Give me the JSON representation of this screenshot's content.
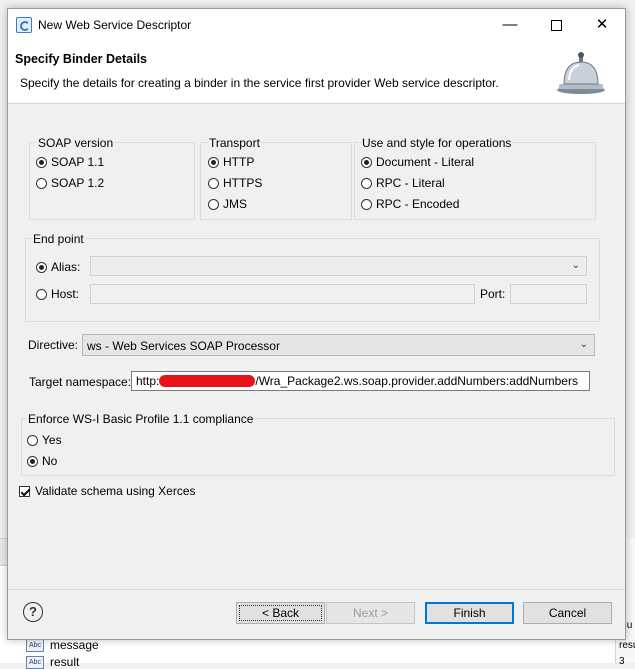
{
  "background_app": {
    "rows": [
      "message",
      "result"
    ],
    "right_col": [
      "alu",
      "resu",
      "3"
    ]
  },
  "window": {
    "title": "New Web Service Descriptor",
    "minimize": "—",
    "close": "✕"
  },
  "header": {
    "title": "Specify Binder Details",
    "description": "Specify the details for creating a binder in the service first provider Web service descriptor."
  },
  "soap_version": {
    "label": "SOAP version",
    "options": [
      "SOAP 1.1",
      "SOAP 1.2"
    ],
    "selected": "SOAP 1.1"
  },
  "transport": {
    "label": "Transport",
    "options": [
      "HTTP",
      "HTTPS",
      "JMS"
    ],
    "selected": "HTTP"
  },
  "use_style": {
    "label": "Use and style for operations",
    "options": [
      "Document - Literal",
      "RPC - Literal",
      "RPC - Encoded"
    ],
    "selected": "Document - Literal"
  },
  "endpoint": {
    "label": "End point",
    "alias_label": "Alias:",
    "alias_value": "",
    "host_label": "Host:",
    "host_value": "",
    "port_label": "Port:",
    "port_value": "",
    "selected": "Alias"
  },
  "directive": {
    "label": "Directive:",
    "value": "ws - Web Services SOAP Processor"
  },
  "target_namespace": {
    "label": "Target namespace:",
    "prefix": "http:",
    "suffix": "/Wra_Package2.ws.soap.provider.addNumbers:addNumbers"
  },
  "wsi": {
    "label": "Enforce WS-I Basic Profile 1.1 compliance",
    "options": [
      "Yes",
      "No"
    ],
    "selected": "No"
  },
  "validate": {
    "label": "Validate schema using Xerces",
    "checked": true
  },
  "buttons": {
    "help": "?",
    "back": "< Back",
    "next": "Next >",
    "finish": "Finish",
    "cancel": "Cancel"
  }
}
